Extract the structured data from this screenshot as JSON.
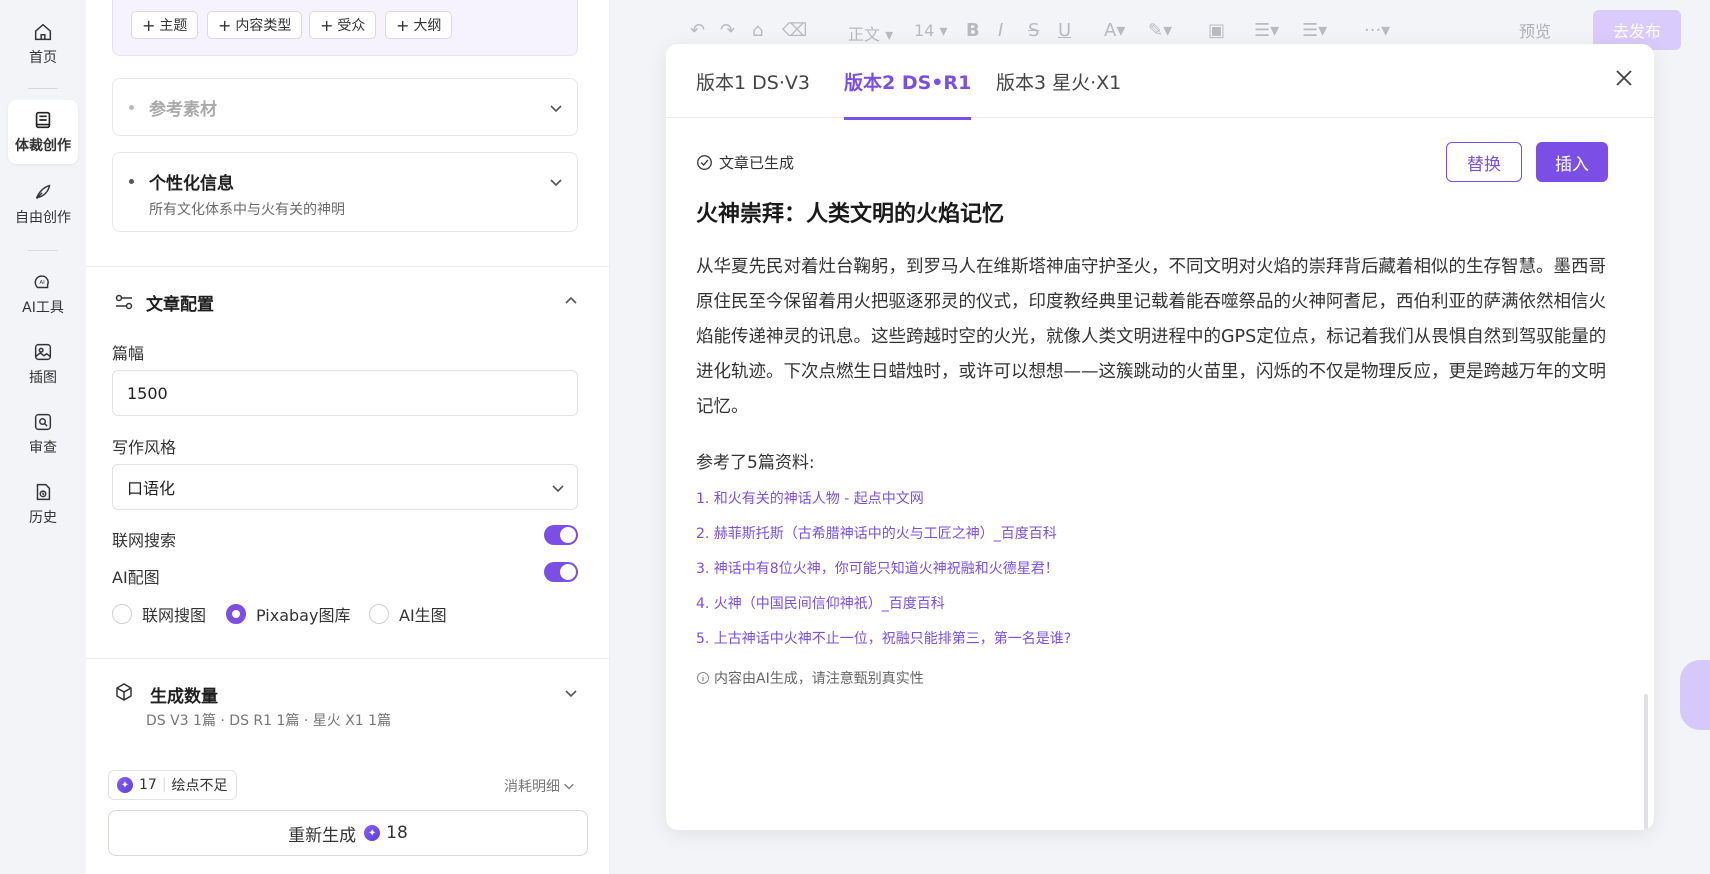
{
  "nav": {
    "items": [
      {
        "label": "首页",
        "icon": "home-icon"
      },
      {
        "label": "体裁创作",
        "icon": "book-icon"
      },
      {
        "label": "自由创作",
        "icon": "pen-icon"
      },
      {
        "label": "AI工具",
        "icon": "ai-icon"
      },
      {
        "label": "插图",
        "icon": "image-icon"
      },
      {
        "label": "审查",
        "icon": "review-icon"
      },
      {
        "label": "历史",
        "icon": "history-icon"
      }
    ]
  },
  "left": {
    "tags": [
      "主题",
      "内容类型",
      "受众",
      "大纲"
    ],
    "reference": {
      "title": "参考素材"
    },
    "personal": {
      "title": "个性化信息",
      "subtitle": "所有文化体系中与火有关的神明"
    },
    "config": {
      "title": "文章配置",
      "length_label": "篇幅",
      "length_value": "1500",
      "style_label": "写作风格",
      "style_value": "口语化",
      "web_search_label": "联网搜索",
      "ai_image_label": "AI配图",
      "image_options": [
        "联网搜图",
        "Pixabay图库",
        "AI生图"
      ],
      "selected_image_option": "Pixabay图库"
    },
    "count": {
      "title": "生成数量",
      "subtitle": "DS V3 1篇 · DS R1 1篇 · 星火 X1 1篇"
    },
    "points": {
      "value": "17",
      "note": "绘点不足",
      "detail_label": "消耗明细"
    },
    "regen": {
      "label": "重新生成",
      "cost": "18"
    }
  },
  "toolbar": {
    "paragraph_style": "正文",
    "font_size": "14",
    "preview_label": "预览",
    "publish_label": "去发布"
  },
  "modal": {
    "tabs": [
      "版本1 DS·V3",
      "版本2 DS•R1",
      "版本3 星火·X1"
    ],
    "active_tab": 1,
    "status": "文章已生成",
    "replace_label": "替换",
    "insert_label": "插入",
    "article_title": "火神崇拜：人类文明的火焰记忆",
    "article_body": "从华夏先民对着灶台鞠躬，到罗马人在维斯塔神庙守护圣火，不同文明对火焰的崇拜背后藏着相似的生存智慧。墨西哥原住民至今保留着用火把驱逐邪灵的仪式，印度教经典里记载着能吞噬祭品的火神阿耆尼，西伯利亚的萨满依然相信火焰能传递神灵的讯息。这些跨越时空的火光，就像人类文明进程中的GPS定位点，标记着我们从畏惧自然到驾驭能量的进化轨迹。下次点燃生日蜡烛时，或许可以想想——这簇跳动的火苗里，闪烁的不仅是物理反应，更是跨越万年的文明记忆。",
    "refs_heading": "参考了5篇资料:",
    "refs": [
      "1. 和火有关的神话人物 - 起点中文网",
      "2. 赫菲斯托斯（古希腊神话中的火与工匠之神）_百度百科",
      "3. 神话中有8位火神，你可能只知道火神祝融和火德星君！",
      "4. 火神（中国民间信仰神祇）_百度百科",
      "5. 上古神话中火神不止一位，祝融只能排第三，第一名是谁?"
    ],
    "disclaimer": "内容由AI生成，请注意甄别真实性"
  },
  "colors": {
    "accent": "#7b4fe6",
    "publish_disabled": "#d9cbfb"
  }
}
